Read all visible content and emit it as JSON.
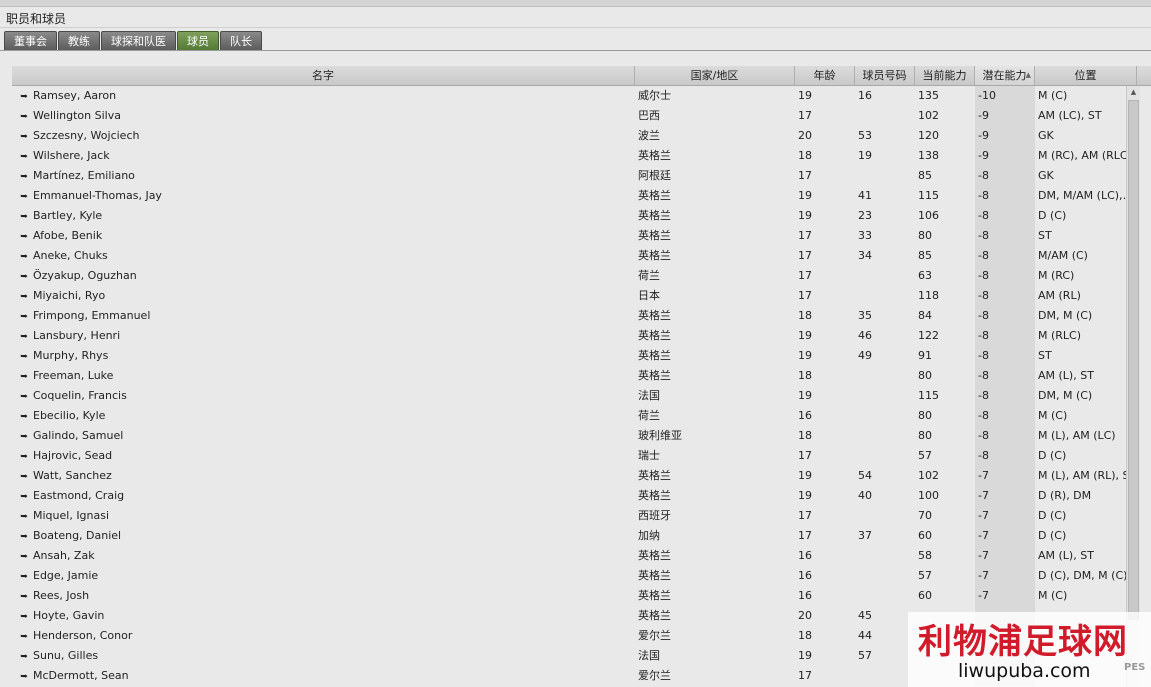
{
  "window": {
    "title": "职员和球员"
  },
  "tabs": [
    {
      "label": "董事会"
    },
    {
      "label": "教练"
    },
    {
      "label": "球探和队医"
    },
    {
      "label": "球员"
    },
    {
      "label": "队长"
    }
  ],
  "active_tab": "球员",
  "columns": {
    "name": "名字",
    "nationality": "国家/地区",
    "age": "年龄",
    "squad_number": "球员号码",
    "current_ability": "当前能力",
    "potential_ability": "潜在能力",
    "position": "位置"
  },
  "sort_indicator": "▲",
  "rows": [
    {
      "name": "Ramsey, Aaron",
      "nat": "威尔士",
      "age": "19",
      "num": "16",
      "ca": "135",
      "pa": "-10",
      "pos": "M (C)"
    },
    {
      "name": "Wellington Silva",
      "nat": "巴西",
      "age": "17",
      "num": "",
      "ca": "102",
      "pa": "-9",
      "pos": "AM (LC), ST"
    },
    {
      "name": "Szczesny, Wojciech",
      "nat": "波兰",
      "age": "20",
      "num": "53",
      "ca": "120",
      "pa": "-9",
      "pos": "GK"
    },
    {
      "name": "Wilshere, Jack",
      "nat": "英格兰",
      "age": "18",
      "num": "19",
      "ca": "138",
      "pa": "-9",
      "pos": "M (RC), AM (RLC)"
    },
    {
      "name": "Martínez, Emiliano",
      "nat": "阿根廷",
      "age": "17",
      "num": "",
      "ca": "85",
      "pa": "-8",
      "pos": "GK"
    },
    {
      "name": "Emmanuel-Thomas, Jay",
      "nat": "英格兰",
      "age": "19",
      "num": "41",
      "ca": "115",
      "pa": "-8",
      "pos": "DM, M/AM (LC), S.."
    },
    {
      "name": "Bartley, Kyle",
      "nat": "英格兰",
      "age": "19",
      "num": "23",
      "ca": "106",
      "pa": "-8",
      "pos": "D (C)"
    },
    {
      "name": "Afobe, Benik",
      "nat": "英格兰",
      "age": "17",
      "num": "33",
      "ca": "80",
      "pa": "-8",
      "pos": "ST"
    },
    {
      "name": "Aneke, Chuks",
      "nat": "英格兰",
      "age": "17",
      "num": "34",
      "ca": "85",
      "pa": "-8",
      "pos": "M/AM (C)"
    },
    {
      "name": "Özyakup, Oguzhan",
      "nat": "荷兰",
      "age": "17",
      "num": "",
      "ca": "63",
      "pa": "-8",
      "pos": "M (RC)"
    },
    {
      "name": "Miyaichi, Ryo",
      "nat": "日本",
      "age": "17",
      "num": "",
      "ca": "118",
      "pa": "-8",
      "pos": "AM (RL)"
    },
    {
      "name": "Frimpong, Emmanuel",
      "nat": "英格兰",
      "age": "18",
      "num": "35",
      "ca": "84",
      "pa": "-8",
      "pos": "DM, M (C)"
    },
    {
      "name": "Lansbury, Henri",
      "nat": "英格兰",
      "age": "19",
      "num": "46",
      "ca": "122",
      "pa": "-8",
      "pos": "M (RLC)"
    },
    {
      "name": "Murphy, Rhys",
      "nat": "英格兰",
      "age": "19",
      "num": "49",
      "ca": "91",
      "pa": "-8",
      "pos": "ST"
    },
    {
      "name": "Freeman, Luke",
      "nat": "英格兰",
      "age": "18",
      "num": "",
      "ca": "80",
      "pa": "-8",
      "pos": "AM (L), ST"
    },
    {
      "name": "Coquelin, Francis",
      "nat": "法国",
      "age": "19",
      "num": "",
      "ca": "115",
      "pa": "-8",
      "pos": "DM, M (C)"
    },
    {
      "name": "Ebecilio, Kyle",
      "nat": "荷兰",
      "age": "16",
      "num": "",
      "ca": "80",
      "pa": "-8",
      "pos": "M (C)"
    },
    {
      "name": "Galindo, Samuel",
      "nat": "玻利维亚",
      "age": "18",
      "num": "",
      "ca": "80",
      "pa": "-8",
      "pos": "M (L), AM (LC)"
    },
    {
      "name": "Hajrovic, Sead",
      "nat": "瑞士",
      "age": "17",
      "num": "",
      "ca": "57",
      "pa": "-8",
      "pos": "D (C)"
    },
    {
      "name": "Watt, Sanchez",
      "nat": "英格兰",
      "age": "19",
      "num": "54",
      "ca": "102",
      "pa": "-7",
      "pos": "M (L), AM (RL), ST"
    },
    {
      "name": "Eastmond, Craig",
      "nat": "英格兰",
      "age": "19",
      "num": "40",
      "ca": "100",
      "pa": "-7",
      "pos": "D (R), DM"
    },
    {
      "name": "Miquel, Ignasi",
      "nat": "西班牙",
      "age": "17",
      "num": "",
      "ca": "70",
      "pa": "-7",
      "pos": "D (C)"
    },
    {
      "name": "Boateng, Daniel",
      "nat": "加纳",
      "age": "17",
      "num": "37",
      "ca": "60",
      "pa": "-7",
      "pos": "D (C)"
    },
    {
      "name": "Ansah, Zak",
      "nat": "英格兰",
      "age": "16",
      "num": "",
      "ca": "58",
      "pa": "-7",
      "pos": "AM (L), ST"
    },
    {
      "name": "Edge, Jamie",
      "nat": "英格兰",
      "age": "16",
      "num": "",
      "ca": "57",
      "pa": "-7",
      "pos": "D (C), DM, M (C)"
    },
    {
      "name": "Rees, Josh",
      "nat": "英格兰",
      "age": "16",
      "num": "",
      "ca": "60",
      "pa": "-7",
      "pos": "M (C)"
    },
    {
      "name": "Hoyte, Gavin",
      "nat": "英格兰",
      "age": "20",
      "num": "45",
      "ca": "",
      "pa": "",
      "pos": ""
    },
    {
      "name": "Henderson, Conor",
      "nat": "爱尔兰",
      "age": "18",
      "num": "44",
      "ca": "",
      "pa": "",
      "pos": ""
    },
    {
      "name": "Sunu, Gilles",
      "nat": "法国",
      "age": "19",
      "num": "57",
      "ca": "",
      "pa": "",
      "pos": ""
    },
    {
      "name": "McDermott, Sean",
      "nat": "爱尔兰",
      "age": "17",
      "num": "",
      "ca": "",
      "pa": "",
      "pos": ""
    }
  ],
  "watermark": {
    "main": "利物浦足球网",
    "sub": "liwupuba.com",
    "mark": "PES"
  }
}
